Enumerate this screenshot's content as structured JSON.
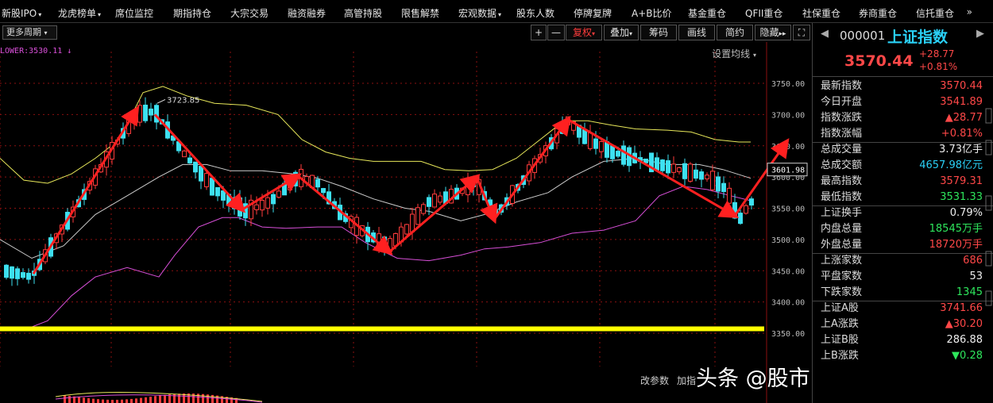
{
  "nav": {
    "items": [
      {
        "label": "新股IPO",
        "caret": true
      },
      {
        "label": "龙虎榜单",
        "caret": true
      },
      {
        "label": "席位监控",
        "caret": false
      },
      {
        "label": "期指持仓",
        "caret": false
      },
      {
        "label": "大宗交易",
        "caret": false
      },
      {
        "label": "融资融券",
        "caret": false
      },
      {
        "label": "高管持股",
        "caret": false
      },
      {
        "label": "限售解禁",
        "caret": false
      },
      {
        "label": "宏观数据",
        "caret": true
      },
      {
        "label": "股东人数",
        "caret": false
      },
      {
        "label": "停牌复牌",
        "caret": false
      },
      {
        "label": "A+B比价",
        "caret": false
      },
      {
        "label": "基金重仓",
        "caret": false
      },
      {
        "label": "QFII重仓",
        "caret": false
      },
      {
        "label": "社保重仓",
        "caret": false
      },
      {
        "label": "券商重仓",
        "caret": false
      },
      {
        "label": "信托重仓",
        "caret": false
      }
    ],
    "more": "»"
  },
  "toolbar": {
    "period": "更多周期",
    "plus": "+",
    "minus": "—",
    "restore": "复权",
    "overlay": "叠加",
    "chips": "筹码",
    "draw": "画线",
    "simple": "简约",
    "hide": "隐藏",
    "hide_arrow": "▸▸",
    "fullscreen": "⛶"
  },
  "chart": {
    "indicator_label": "LOWER:3530.11 ↓",
    "ma_setting": "设置均线",
    "peak_label": "3723.85",
    "current_tag": "3601.98",
    "bottom_labels": [
      "改参数",
      "加指"
    ],
    "y_ticks": [
      "3750.00",
      "3700.00",
      "3650.00",
      "3600.00",
      "3550.00",
      "3500.00",
      "3450.00",
      "3400.00",
      "3350.00"
    ],
    "colors": {
      "up": "#ff3c3c",
      "down": "#3de0f0",
      "mid": "#cccccc",
      "upper": "#e8e85a",
      "lower": "#d84fd8",
      "trend": "#ff2020",
      "support": "#ffff00"
    }
  },
  "watermark": "头条 @股市中奔跑的狼哥",
  "side": {
    "code": "000001",
    "name": "上证指数",
    "price": "3570.44",
    "change": "+28.77",
    "change_pct": "+0.81%",
    "rows": [
      {
        "label": "最新指数",
        "value": "3570.44",
        "color": "red"
      },
      {
        "label": "今日开盘",
        "value": "3541.89",
        "color": "red"
      },
      {
        "label": "指数涨跌",
        "value": "▲28.77",
        "color": "red"
      },
      {
        "label": "指数涨幅",
        "value": "+0.81%",
        "color": "red"
      },
      {
        "label": "总成交量",
        "value": "3.73亿手",
        "color": "white"
      },
      {
        "label": "总成交额",
        "value": "4657.98亿元",
        "color": "cyan"
      },
      {
        "label": "最高指数",
        "value": "3579.31",
        "color": "red"
      },
      {
        "label": "最低指数",
        "value": "3531.33",
        "color": "green"
      },
      {
        "label": "上证换手",
        "value": "0.79%",
        "color": "white"
      },
      {
        "label": "内盘总量",
        "value": "18545万手",
        "color": "green"
      },
      {
        "label": "外盘总量",
        "value": "18720万手",
        "color": "red"
      },
      {
        "label": "上涨家数",
        "value": "686",
        "color": "red"
      },
      {
        "label": "平盘家数",
        "value": "53",
        "color": "white"
      },
      {
        "label": "下跌家数",
        "value": "1345",
        "color": "green"
      },
      {
        "label": "上证A股",
        "value": "3741.66",
        "color": "red"
      },
      {
        "label": "上A涨跌",
        "value": "▲30.20",
        "color": "red"
      },
      {
        "label": "上证B股",
        "value": "286.88",
        "color": "white"
      },
      {
        "label": "上B涨跌",
        "value": "▼0.28",
        "color": "green"
      }
    ]
  }
}
